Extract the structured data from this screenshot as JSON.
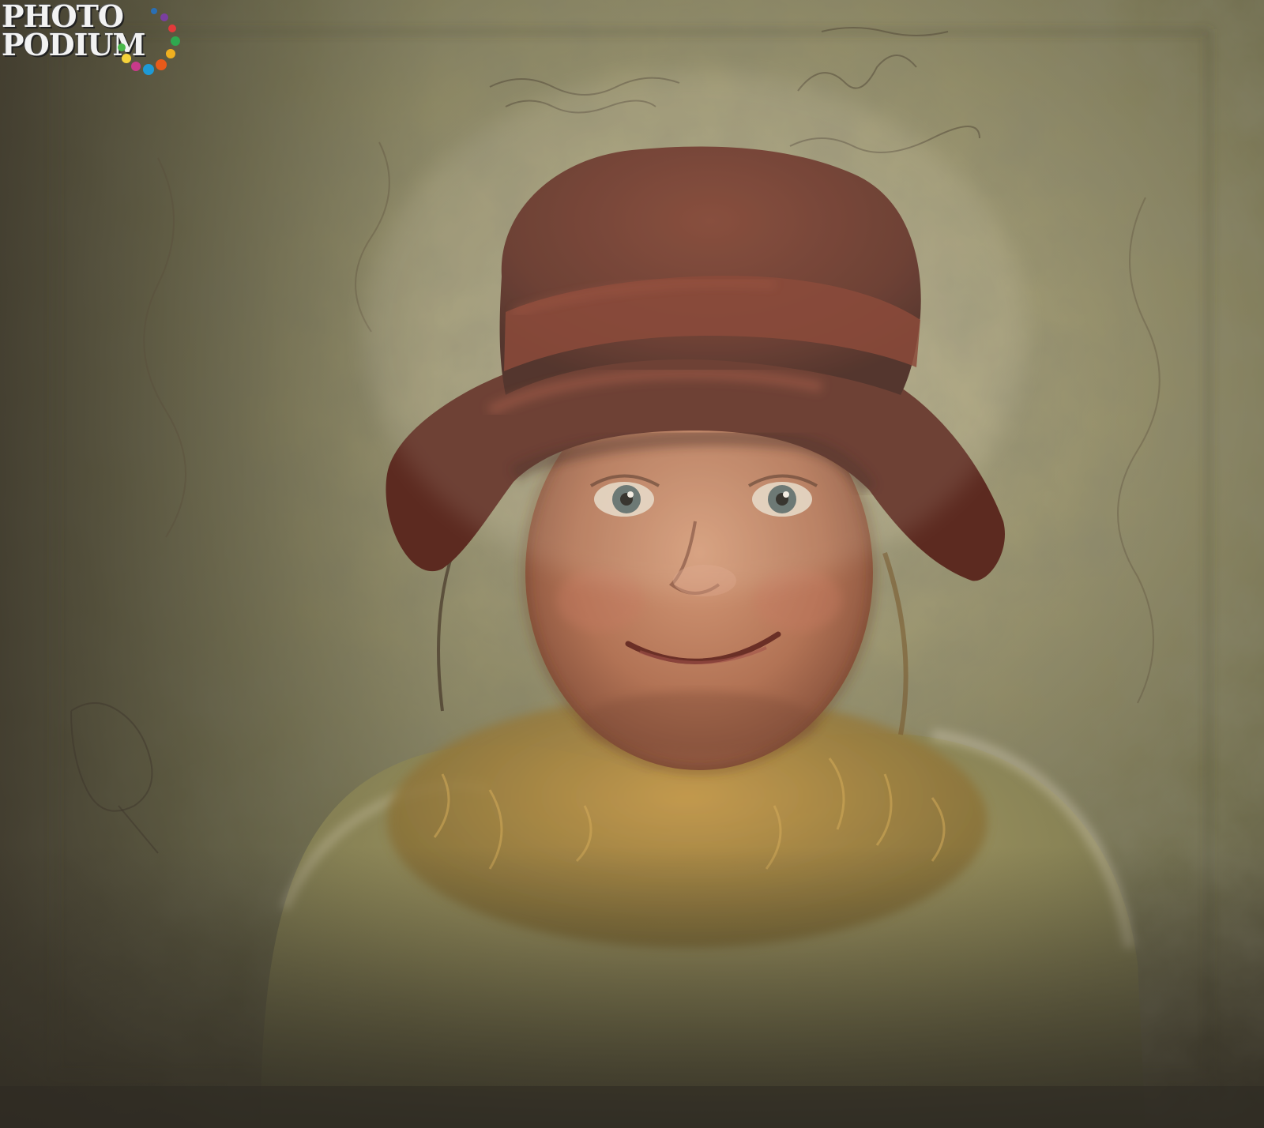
{
  "watermark": {
    "line1": "PHOTO",
    "line2": "PODIUM"
  },
  "photo": {
    "subject": "painterly-child-portrait",
    "palette": {
      "background": "#6b6a48",
      "paper_light": "#cfc3a2",
      "hat": "#6e2f22",
      "hat_band": "#8a3a2a",
      "skin": "#b8765a",
      "hair": "#a8823a",
      "coat": "#8e8a5c",
      "eyes": "#5d6a6a"
    }
  }
}
